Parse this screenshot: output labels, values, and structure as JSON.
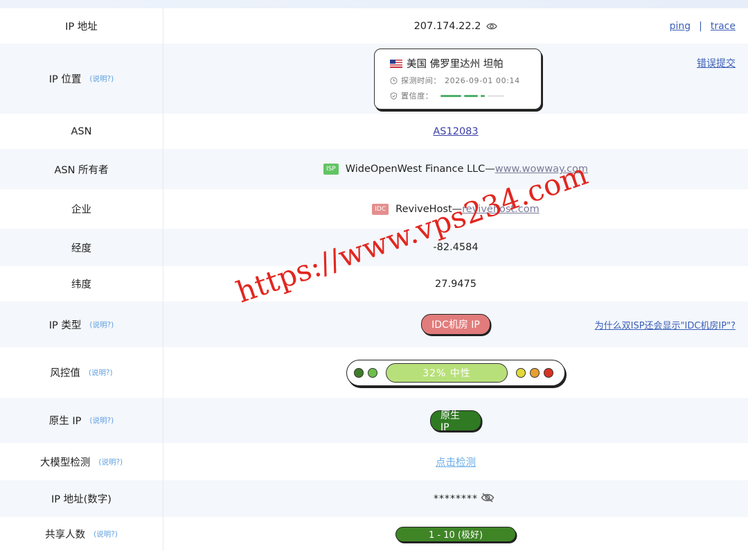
{
  "rows": {
    "ip": {
      "label": "IP 地址",
      "value": "207.174.22.2",
      "ping": "ping",
      "sep": "|",
      "trace": "trace"
    },
    "location": {
      "label": "IP 位置",
      "help": "(说明?)",
      "place": "美国 佛罗里达州 坦帕",
      "detect_label": "探测时间：",
      "detect_time": "2026-09-01 00:14",
      "confidence_label": "置信度：",
      "report": "错误提交"
    },
    "asn": {
      "label": "ASN",
      "value": "AS12083"
    },
    "asn_owner": {
      "label": "ASN 所有者",
      "tag": "ISP",
      "name": "WideOpenWest Finance LLC—",
      "site": "www.wowway.com"
    },
    "company": {
      "label": "企业",
      "tag": "IDC",
      "name": "ReviveHost—",
      "site": "revivehost.com"
    },
    "longitude": {
      "label": "经度",
      "value": "-82.4584"
    },
    "latitude": {
      "label": "纬度",
      "value": "27.9475"
    },
    "ip_type": {
      "label": "IP 类型",
      "help": "(说明?)",
      "value": "IDC机房 IP",
      "question": "为什么双ISP还会显示\"IDC机房IP\"?"
    },
    "risk": {
      "label": "风控值",
      "help": "(说明?)",
      "value": "32%  中性"
    },
    "native": {
      "label": "原生 IP",
      "help": "(说明?)",
      "value": "原生 IP"
    },
    "llm": {
      "label": "大模型检测",
      "help": "(说明?)",
      "value": "点击检测"
    },
    "ip_numeric": {
      "label": "IP 地址(数字)",
      "value": "********"
    },
    "shared": {
      "label": "共享人数",
      "help": "(说明?)",
      "value": "1 - 10 (极好)"
    }
  },
  "watermark": "https://www.vps234.com",
  "colors": {
    "link": "#3b5fb8",
    "help": "#5fa0e0",
    "idc_pill": "#e27c7c",
    "native_pill": "#2f7a22",
    "risk_bar": "#b8e07a",
    "watermark": "#e2261f"
  },
  "confidence_level": 0.6,
  "risk_dots": [
    "#3f7d2a",
    "#6cc04a",
    "#e2d83a",
    "#e6a030",
    "#d83222"
  ]
}
